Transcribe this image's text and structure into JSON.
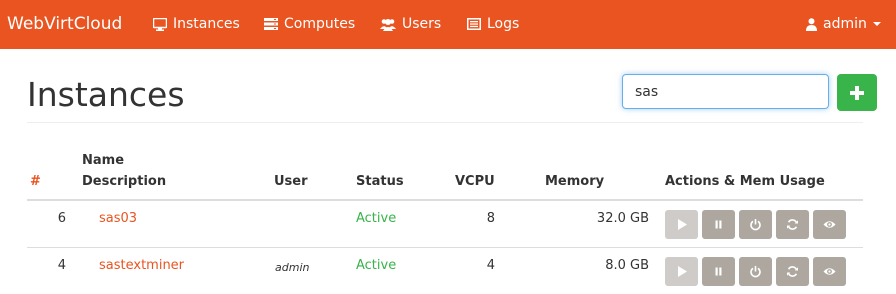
{
  "navbar": {
    "brand": "WebVirtCloud",
    "items": [
      {
        "label": "Instances",
        "icon": "monitor-icon"
      },
      {
        "label": "Computes",
        "icon": "server-icon"
      },
      {
        "label": "Users",
        "icon": "users-icon"
      },
      {
        "label": "Logs",
        "icon": "list-icon"
      }
    ],
    "user": {
      "label": "admin",
      "icon": "user-icon"
    }
  },
  "page": {
    "title": "Instances",
    "search_value": "sas"
  },
  "table": {
    "headers": {
      "hash": "#",
      "name_line1": "Name",
      "name_line2": "Description",
      "user": "User",
      "status": "Status",
      "vcpu": "VCPU",
      "memory": "Memory",
      "actions": "Actions & Mem Usage"
    },
    "rows": [
      {
        "id": "6",
        "name": "sas03",
        "user": "",
        "status": "Active",
        "vcpu": "8",
        "memory": "32.0 GB"
      },
      {
        "id": "4",
        "name": "sastextminer",
        "user": "admin",
        "status": "Active",
        "vcpu": "4",
        "memory": "8.0 GB"
      }
    ],
    "actions": [
      "play-icon",
      "pause-icon",
      "power-icon",
      "refresh-icon",
      "eye-icon"
    ]
  },
  "colors": {
    "navbar": "#e95420",
    "accent": "#e95420",
    "success": "#38b44a",
    "action_button": "#aea79f",
    "action_button_disabled": "#cfcbc8"
  }
}
